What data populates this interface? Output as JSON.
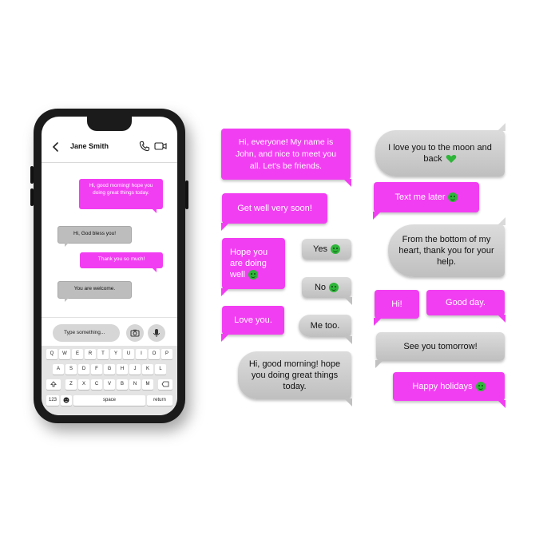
{
  "phone": {
    "contact_name": "Jane Smith",
    "messages": [
      {
        "type": "sent",
        "text": "Hi, good morning! hope you doing great things today."
      },
      {
        "type": "recv",
        "text": "Hi, God bless you!"
      },
      {
        "type": "sent",
        "text": "Thank you so much!"
      },
      {
        "type": "recv",
        "text": "You are welcome."
      }
    ],
    "input_placeholder": "Type something...",
    "keyboard": {
      "row1": [
        "Q",
        "W",
        "E",
        "R",
        "T",
        "Y",
        "U",
        "I",
        "O",
        "P"
      ],
      "row2": [
        "A",
        "S",
        "D",
        "F",
        "G",
        "H",
        "J",
        "K",
        "L"
      ],
      "row3": [
        "Z",
        "X",
        "C",
        "V",
        "B",
        "N",
        "M"
      ],
      "numbers_key": "123",
      "space_key": "space",
      "return_key": "return"
    }
  },
  "stickers": {
    "s1": "Hi, everyone! My name is John, and nice to meet you all. Let's be friends.",
    "s2": "Get well very soon!",
    "s3": "Hope you are doing well",
    "s4": "Yes",
    "s5": "No",
    "s6": "Love you.",
    "s7": "Me too.",
    "s8": "Hi, good morning! hope you doing great things today.",
    "s9": "I love you to the moon and back",
    "s10": "Text me later",
    "s11": "From the bottom of my heart, thank you for your help.",
    "s12": "Hi!",
    "s13": "Good day.",
    "s14": "See you tomorrow!",
    "s15": "Happy holidays"
  },
  "colors": {
    "accent_pink": "#f23ef2",
    "bubble_grey": "#c4c4c4",
    "emoji_green": "#2fb53a"
  },
  "icons": [
    "back-arrow-icon",
    "phone-icon",
    "video-camera-icon",
    "camera-icon",
    "microphone-icon",
    "backspace-icon",
    "emoji-icon",
    "shift-icon"
  ]
}
